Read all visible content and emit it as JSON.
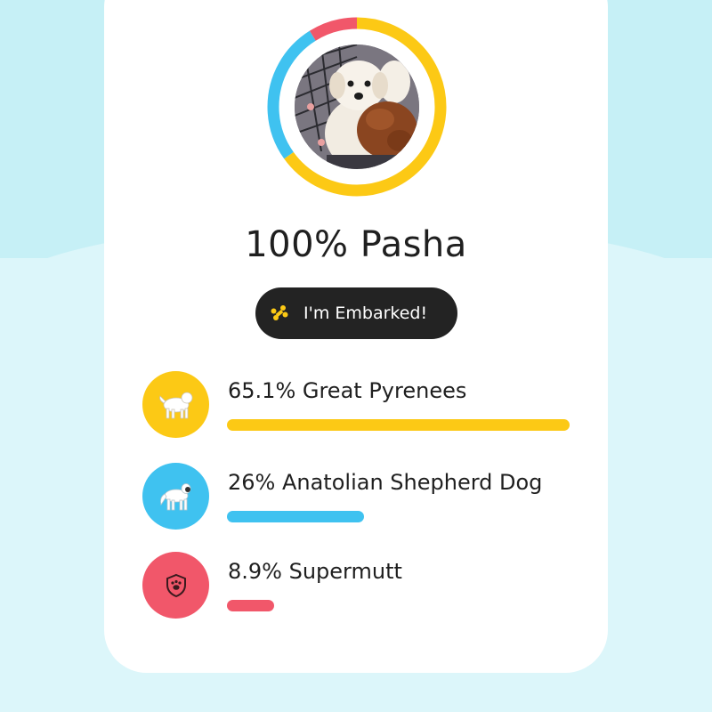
{
  "profile": {
    "name": "100% Pasha",
    "badge_label": "I'm Embarked!",
    "ring_colors": {
      "yellow": "#fcc915",
      "blue": "#3fc2f0",
      "red": "#f1576a"
    }
  },
  "breeds": [
    {
      "label": "65.1% Great Pyrenees",
      "percent": 65.1,
      "color": "#fcc915",
      "icon": "great-pyrenees-icon"
    },
    {
      "label": "26% Anatolian Shepherd Dog",
      "percent": 26,
      "color": "#3fc2f0",
      "icon": "anatolian-shepherd-icon"
    },
    {
      "label": "8.9% Supermutt",
      "percent": 8.9,
      "color": "#f1576a",
      "icon": "supermutt-shield-icon"
    }
  ]
}
